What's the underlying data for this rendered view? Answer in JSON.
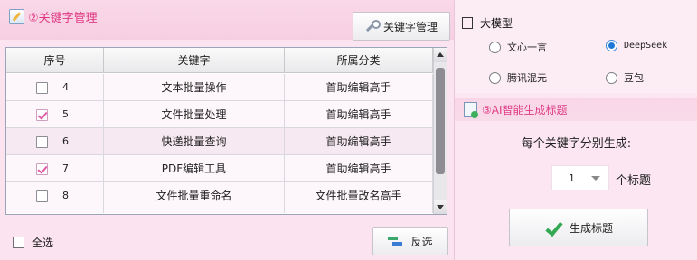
{
  "keyword_panel": {
    "title": "②关键字管理",
    "manage_button": "关键字管理",
    "table": {
      "headers": [
        "序号",
        "关键字",
        "所属分类"
      ],
      "rows": [
        {
          "seq": "4",
          "keyword": "文本批量操作",
          "category": "首助编辑高手",
          "checked": false
        },
        {
          "seq": "5",
          "keyword": "文件批量处理",
          "category": "首助编辑高手",
          "checked": true
        },
        {
          "seq": "6",
          "keyword": "快递批量查询",
          "category": "首助编辑高手",
          "checked": false
        },
        {
          "seq": "7",
          "keyword": "PDF编辑工具",
          "category": "首助编辑高手",
          "checked": true
        },
        {
          "seq": "8",
          "keyword": "文件批量重命名",
          "category": "文件批量改名高手",
          "checked": false
        }
      ]
    },
    "select_all_label": "全选",
    "invert_button": "反选"
  },
  "model_panel": {
    "title": "大模型",
    "options": [
      {
        "label": "文心一言",
        "selected": false
      },
      {
        "label": "DeepSeek",
        "selected": true
      },
      {
        "label": "腾讯混元",
        "selected": false
      },
      {
        "label": "豆包",
        "selected": false
      }
    ]
  },
  "ai_panel": {
    "title": "③AI智能生成标题",
    "per_keyword_label": "每个关键字分别生成:",
    "count_value": "1",
    "count_unit": "个标题",
    "generate_button": "生成标题"
  },
  "colors": {
    "accent_pink": "#e03a84",
    "background": "#fbe3ef",
    "radio_selected": "#1e78d6"
  }
}
